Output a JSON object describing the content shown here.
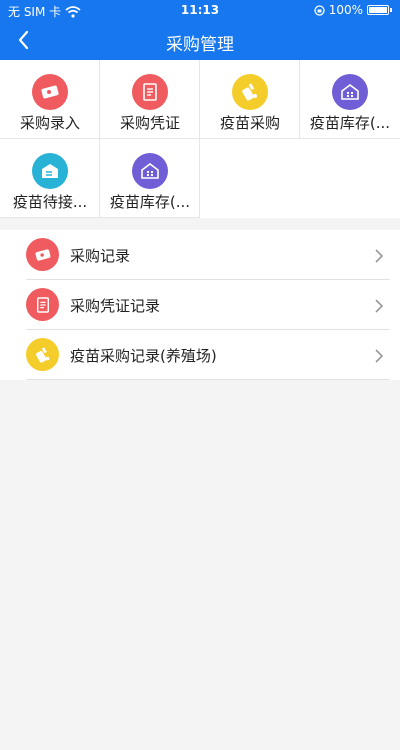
{
  "status": {
    "carrier": "无 SIM 卡",
    "time": "11:13",
    "battery": "100%"
  },
  "nav": {
    "title": "采购管理"
  },
  "grid": [
    {
      "label": "采购录入",
      "icon": "ticket-icon",
      "color": "#ef5b5f"
    },
    {
      "label": "采购凭证",
      "icon": "receipt-icon",
      "color": "#ef5b5f"
    },
    {
      "label": "疫苗采购",
      "icon": "vaccine-icon",
      "color": "#f5cd2b"
    },
    {
      "label": "疫苗库存(...",
      "icon": "warehouse-icon",
      "color": "#6f5ed6"
    },
    {
      "label": "疫苗待接...",
      "icon": "inbox-icon",
      "color": "#27b2d6"
    },
    {
      "label": "疫苗库存(...",
      "icon": "warehouse-icon",
      "color": "#6f5ed6"
    }
  ],
  "list": [
    {
      "label": "采购记录",
      "icon": "ticket-icon",
      "color": "#ef5b5f"
    },
    {
      "label": "采购凭证记录",
      "icon": "receipt-icon",
      "color": "#ef5b5f"
    },
    {
      "label": "疫苗采购记录(养殖场)",
      "icon": "vaccine-icon",
      "color": "#f5cd2b"
    }
  ]
}
